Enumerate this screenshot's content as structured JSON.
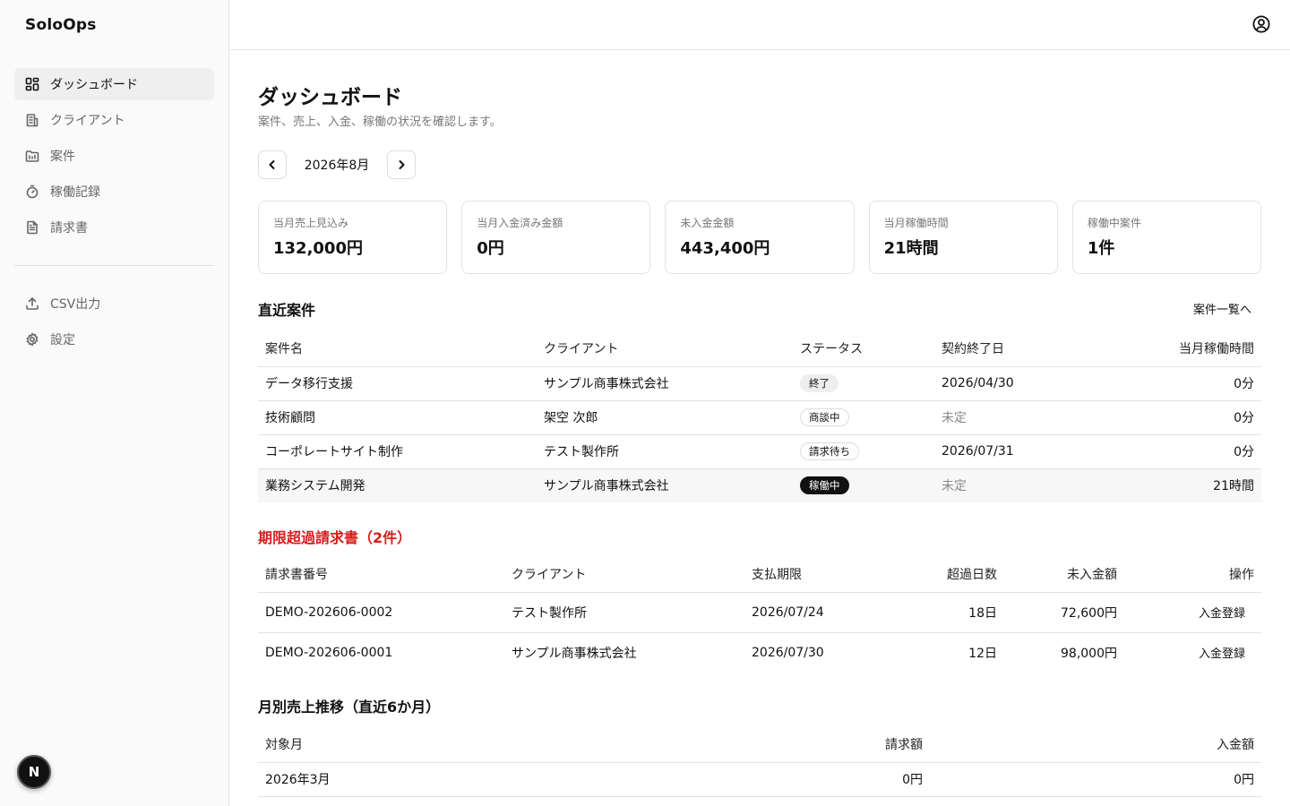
{
  "app": {
    "name": "SoloOps"
  },
  "sidebar": {
    "items": [
      {
        "label": "ダッシュボード",
        "icon": "dashboard-icon",
        "active": true
      },
      {
        "label": "クライアント",
        "icon": "building-icon",
        "active": false
      },
      {
        "label": "案件",
        "icon": "folder-icon",
        "active": false
      },
      {
        "label": "稼働記録",
        "icon": "timer-icon",
        "active": false
      },
      {
        "label": "請求書",
        "icon": "file-text-icon",
        "active": false
      }
    ],
    "secondary": [
      {
        "label": "CSV出力",
        "icon": "upload-icon"
      },
      {
        "label": "設定",
        "icon": "gear-icon"
      }
    ]
  },
  "header": {
    "account_icon": "user-circle-icon"
  },
  "page": {
    "title": "ダッシュボード",
    "subtitle": "案件、売上、入金、稼働の状況を確認します。"
  },
  "month_nav": {
    "label": "2026年8月",
    "prev_icon": "chevron-left-icon",
    "next_icon": "chevron-right-icon"
  },
  "kpis": [
    {
      "label": "当月売上見込み",
      "value": "132,000円"
    },
    {
      "label": "当月入金済み金額",
      "value": "0円"
    },
    {
      "label": "未入金金額",
      "value": "443,400円"
    },
    {
      "label": "当月稼働時間",
      "value": "21時間"
    },
    {
      "label": "稼働中案件",
      "value": "1件"
    }
  ],
  "recent_projects": {
    "title": "直近案件",
    "link": "案件一覧へ",
    "columns": [
      "案件名",
      "クライアント",
      "ステータス",
      "契約終了日",
      "当月稼働時間"
    ],
    "rows": [
      {
        "name": "データ移行支援",
        "client": "サンプル商事株式会社",
        "status": "終了",
        "end": "2026/04/30",
        "hours": "0分"
      },
      {
        "name": "技術顧問",
        "client": "架空 次郎",
        "status": "商談中",
        "end": "未定",
        "hours": "0分"
      },
      {
        "name": "コーポレートサイト制作",
        "client": "テスト製作所",
        "status": "請求待ち",
        "end": "2026/07/31",
        "hours": "0分"
      },
      {
        "name": "業務システム開発",
        "client": "サンプル商事株式会社",
        "status": "稼働中",
        "end": "未定",
        "hours": "21時間"
      }
    ]
  },
  "overdue": {
    "title": "期限超過請求書（2件）",
    "columns": [
      "請求書番号",
      "クライアント",
      "支払期限",
      "超過日数",
      "未入金額",
      "操作"
    ],
    "rows": [
      {
        "number": "DEMO-202606-0002",
        "client": "テスト製作所",
        "due": "2026/07/24",
        "days": "18日",
        "amount": "72,600円",
        "action": "入金登録"
      },
      {
        "number": "DEMO-202606-0001",
        "client": "サンプル商事株式会社",
        "due": "2026/07/30",
        "days": "12日",
        "amount": "98,000円",
        "action": "入金登録"
      }
    ]
  },
  "monthly": {
    "title": "月別売上推移（直近6か月）",
    "columns": [
      "対象月",
      "請求額",
      "入金額"
    ],
    "rows": [
      {
        "month": "2026年3月",
        "billed": "0円",
        "paid": "0円"
      }
    ]
  },
  "dev_badge": {
    "label": "N"
  }
}
